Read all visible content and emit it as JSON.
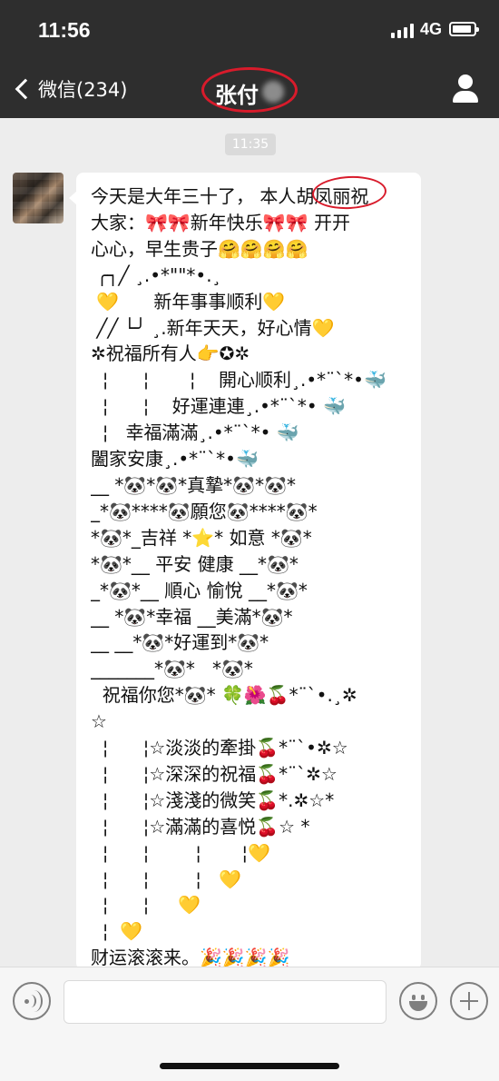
{
  "status_bar": {
    "time": "11:56",
    "network": "4G"
  },
  "nav": {
    "back_label": "微信(234)",
    "contact_name": "张付"
  },
  "chat": {
    "timestamp": "11:35",
    "message_lines": [
      "今天是大年三十了， 本人胡凤丽祝",
      "大家：🎀🎀新年快乐🎀🎀 开开",
      "心心，早生贵子🤗🤗🤗🤗",
      " ╭┐╱ ¸.•*\"\"*•.¸",
      " 💛      新年事事顺利💛",
      " ╱╱ └╯ ¸.新年天天，好心情💛",
      "",
      "✲祝福所有人👉✪✲",
      "  ¦      ¦       ¦    開心顺利¸.•*¨`*•🐳",
      "  ¦      ¦    好運連連¸.•*¨`*• 🐳",
      "  ¦   幸福滿滿¸.•*¨`*• 🐳",
      "闔家安康¸.•*¨`*•🐳",
      "__ *🐼*🐼*真摯*🐼*🐼*",
      "_*🐼****🐼願您🐼****🐼*",
      "*🐼*_吉祥 *⭐* 如意 *🐼*",
      "*🐼*__ 平安 健康 __*🐼*",
      "_*🐼*__ 順心 愉悅 __*🐼*",
      "__ *🐼*幸福 __美滿*🐼*",
      "__ __*🐼*好運到*🐼*",
      "_______*🐼*   *🐼*",
      "  祝福你您*🐼* 🍀🌺🍒*¨`•.¸✲",
      "☆",
      "  ¦      ¦☆淡淡的牽掛🍒*¨`•✲☆",
      "  ¦      ¦☆深深的祝福🍒*¨`✲☆",
      "  ¦      ¦☆淺淺的微笑🍒*.✲☆*",
      "  ¦      ¦☆滿滿的喜悦🍒☆ *",
      "  ¦      ¦        ¦       ¦💛",
      "  ¦      ¦        ¦   💛",
      "  ¦      ¦     💛",
      "  ¦  💛",
      "财运滚滚来。🎉🎉🎉🎉"
    ]
  },
  "input_bar": {
    "message_value": ""
  }
}
